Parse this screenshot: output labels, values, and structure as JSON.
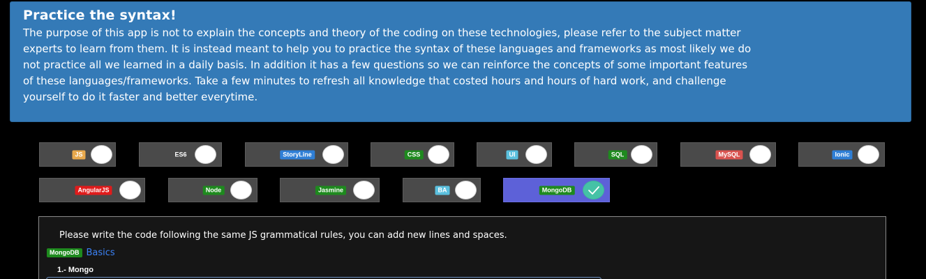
{
  "hero": {
    "title": "Practice the syntax!",
    "lines": [
      "The purpose of this app is not to explain the concepts and theory of the coding on these technologies, please refer to the subject matter",
      "experts to learn from them. It is instead meant to help you to practice the syntax of these languages and frameworks as most likely we do",
      "not practice all we learned in a daily basis. In addition it has a few questions so we can reinforce the concepts of some important features",
      "of these languages/frameworks. Take a few minutes to refresh all knowledge that costed hours and hours of hard work, and challenge",
      "yourself to do it faster and better everytime."
    ],
    "background": "#347ab7"
  },
  "topics": [
    {
      "label": "JS",
      "color": "#e8a94d",
      "checked": false
    },
    {
      "label": "ES6",
      "color": "transparent",
      "checked": false
    },
    {
      "label": "StoryLine",
      "color": "#2f7fd6",
      "checked": false
    },
    {
      "label": "CSS",
      "color": "#1e8a1e",
      "checked": false
    },
    {
      "label": "UI",
      "color": "#5bc0de",
      "checked": false
    },
    {
      "label": "SQL",
      "color": "#1e8a1e",
      "checked": false
    },
    {
      "label": "MySQL",
      "color": "#d9534f",
      "checked": false
    },
    {
      "label": "Ionic",
      "color": "#2f7fd6",
      "checked": false
    },
    {
      "label": "AngularJS",
      "color": "#e01b1b",
      "checked": false
    },
    {
      "label": "Node",
      "color": "#1e8a1e",
      "checked": false
    },
    {
      "label": "Jasmine",
      "color": "#1e8a1e",
      "checked": false
    },
    {
      "label": "BA",
      "color": "#5bc0de",
      "checked": false
    },
    {
      "label": "MongoDB",
      "color": "#1e8a1e",
      "checked": true
    }
  ],
  "exercise": {
    "instruction": "Please write the code following the same JS grammatical rules, you can add new lines and spaces.",
    "tag": "MongoDB",
    "category": "Basics",
    "question": "1.- Mongo"
  },
  "icons": {
    "checked_toggle": "check-icon"
  }
}
